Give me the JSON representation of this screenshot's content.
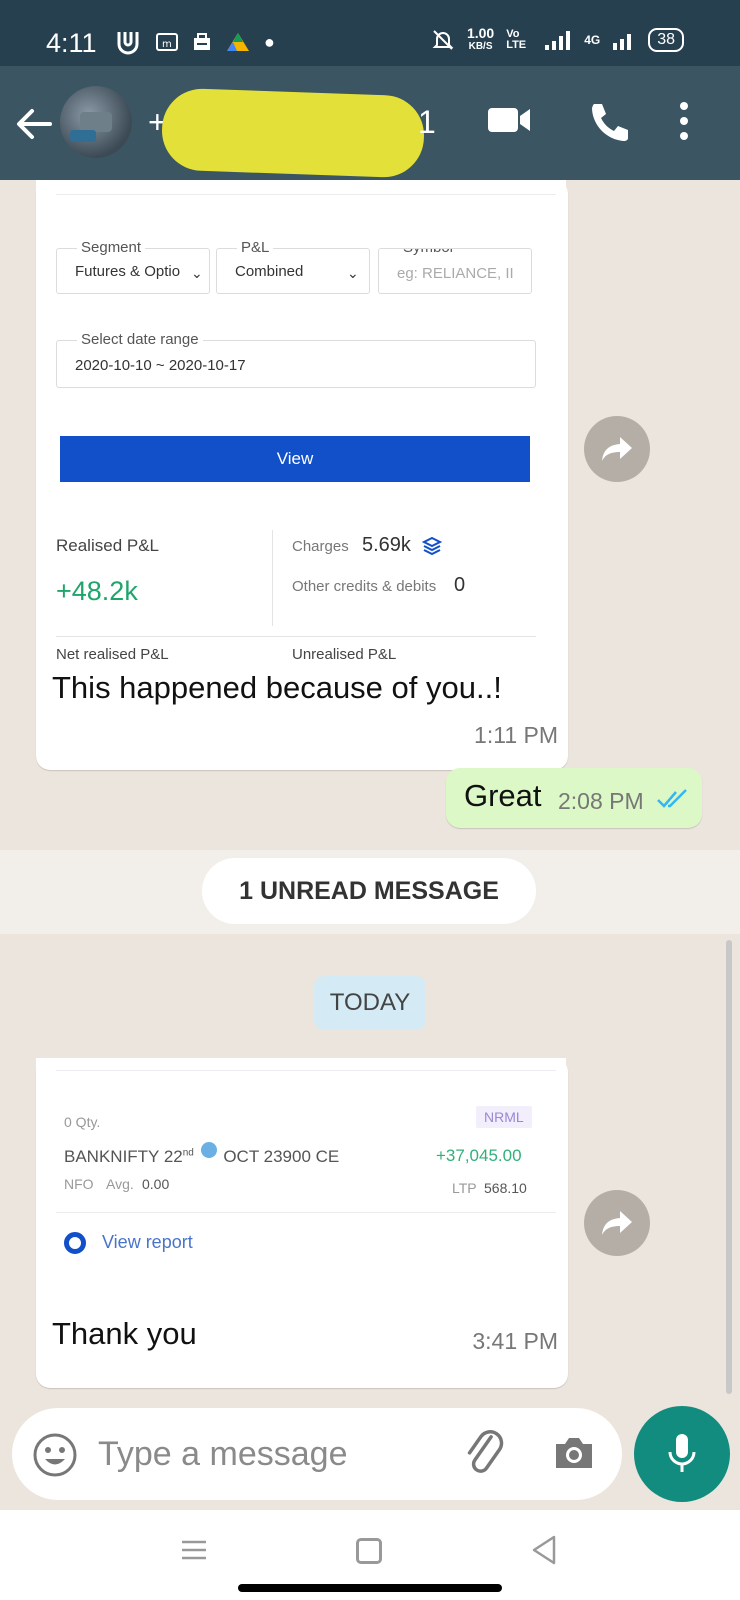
{
  "status_bar": {
    "time": "4:11",
    "speed_value": "1.00",
    "speed_unit": "KB/S",
    "network": "Vo LTE",
    "network2": "4G",
    "battery": "38"
  },
  "header": {
    "contact_prefix": "+",
    "contact_suffix": "1"
  },
  "shot1": {
    "segment_label": "Segment",
    "segment_value": "Futures & Optio",
    "pnl_label": "P&L",
    "pnl_value": "Combined",
    "symbol_label": "Symbol",
    "symbol_placeholder": "eg: RELIANCE, II",
    "date_label": "Select date range",
    "date_value": "2020-10-10 ~ 2020-10-17",
    "view_button": "View",
    "realised_label": "Realised P&L",
    "realised_value": "+48.2k",
    "charges_label": "Charges",
    "charges_value": "5.69k",
    "other_label": "Other credits & debits",
    "other_value": "0",
    "net_label": "Net realised P&L",
    "unrealised_label": "Unrealised P&L"
  },
  "messages": [
    {
      "text": "This happened because of you..!",
      "time": "1:11 PM"
    },
    {
      "text": "Great",
      "time": "2:08 PM"
    },
    {
      "text": "Thank you",
      "time": "3:41 PM"
    }
  ],
  "unread_banner": "1 UNREAD MESSAGE",
  "date_chip": "TODAY",
  "shot2": {
    "qty": "0 Qty.",
    "instrument": "BANKNIFTY 22",
    "instrument_sup": "nd",
    "instrument_rest": "OCT 23900 CE",
    "product": "NRML",
    "pnl": "+37,045.00",
    "exchange": "NFO",
    "avg_label": "Avg.",
    "avg_value": "0.00",
    "ltp_label": "LTP",
    "ltp_value": "568.10",
    "view_report": "View report"
  },
  "input": {
    "placeholder": "Type a message"
  },
  "colors": {
    "status_bar": "#26404f",
    "app_bar": "#3b5563",
    "chat_bg": "#ece5dd",
    "outgoing": "#dcf8c6",
    "accent": "#128c7e",
    "read_ticks": "#34b7f1"
  }
}
